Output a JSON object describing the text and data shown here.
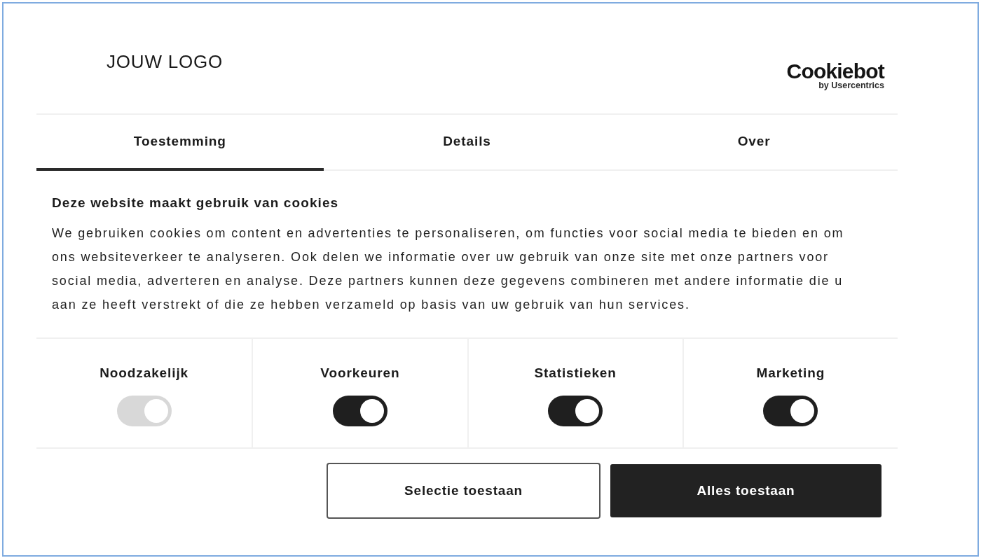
{
  "header": {
    "logo": "JOUW LOGO",
    "brand": {
      "name": "Cookiebot",
      "tagline": "by Usercentrics"
    }
  },
  "tabs": [
    {
      "label": "Toestemming",
      "selected": true
    },
    {
      "label": "Details",
      "selected": false
    },
    {
      "label": "Over",
      "selected": false
    }
  ],
  "consent": {
    "title": "Deze website maakt gebruik van cookies",
    "text": "We gebruiken cookies om content en advertenties te personaliseren, om functies voor social media te bieden en om ons websiteverkeer te analyseren. Ook delen we informatie over uw gebruik van onze site met onze partners voor social media, adverteren en analyse. Deze partners kunnen deze gegevens combineren met andere informatie die u aan ze heeft verstrekt of die ze hebben verzameld op basis van uw gebruik van hun services."
  },
  "categories": [
    {
      "label": "Noodzakelijk",
      "on": true,
      "disabled": true
    },
    {
      "label": "Voorkeuren",
      "on": true,
      "disabled": false
    },
    {
      "label": "Statistieken",
      "on": true,
      "disabled": false
    },
    {
      "label": "Marketing",
      "on": true,
      "disabled": false
    }
  ],
  "buttons": [
    {
      "label": "Selectie toestaan",
      "kind": "outline"
    },
    {
      "label": "Alles toestaan",
      "kind": "filled"
    }
  ]
}
